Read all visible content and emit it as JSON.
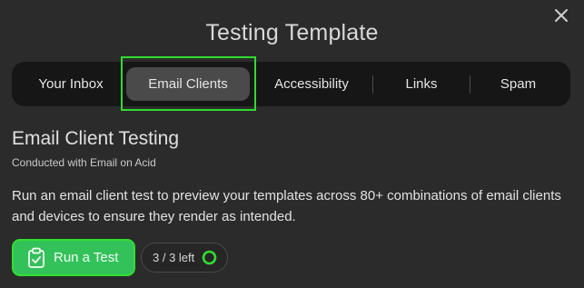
{
  "modal": {
    "title": "Testing Template"
  },
  "tabs": [
    {
      "label": "Your Inbox",
      "active": false
    },
    {
      "label": "Email Clients",
      "active": true
    },
    {
      "label": "Accessibility",
      "active": false
    },
    {
      "label": "Links",
      "active": false
    },
    {
      "label": "Spam",
      "active": false
    }
  ],
  "content": {
    "heading": "Email Client Testing",
    "subheading": "Conducted with Email on Acid",
    "description": "Run an email client test to preview your templates across 80+ combinations of email clients and devices to ensure they render as intended."
  },
  "actions": {
    "run_label": "Run a Test",
    "run_icon": "clipboard-check-icon",
    "quota_text": "3 / 3 left",
    "quota_fraction": 1.0
  },
  "colors": {
    "accent_green": "#33c15a",
    "highlight_green": "#2fdc2f",
    "background": "#2b2b2b",
    "tabbar": "#161616",
    "active_tab": "#4a4a4a"
  },
  "icons": {
    "close": "close-icon",
    "quota_ring": "progress-ring-icon"
  }
}
